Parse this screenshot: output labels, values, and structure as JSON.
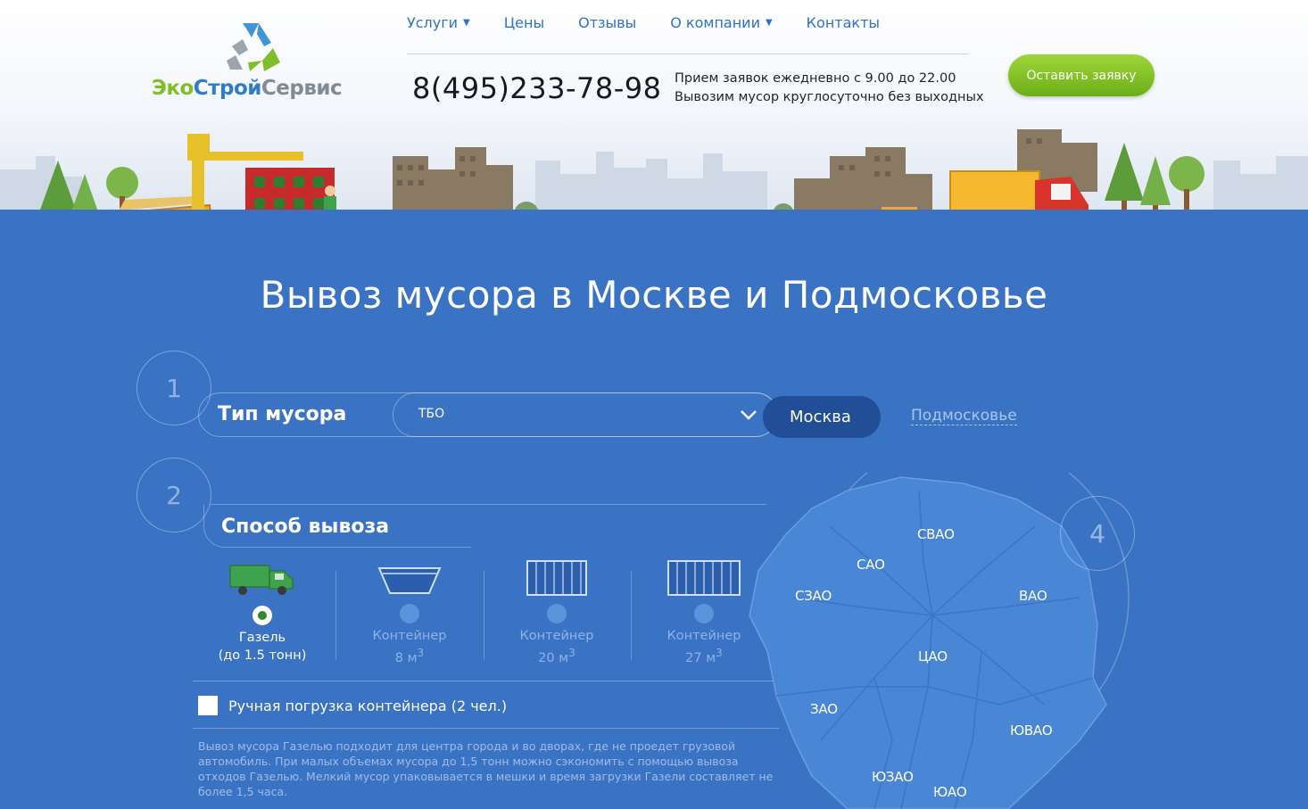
{
  "brand": {
    "logo_part1": "Эко",
    "logo_part2": "Строй",
    "logo_part3": "Сервис",
    "icon": "recycle-icon",
    "colors": {
      "green": "#7fbf2b",
      "blue": "#2f7dc9",
      "grey": "#7f8c97"
    }
  },
  "nav": {
    "items": [
      {
        "label": "Услуги",
        "has_dropdown": true
      },
      {
        "label": "Цены",
        "has_dropdown": false
      },
      {
        "label": "Отзывы",
        "has_dropdown": false
      },
      {
        "label": "О компании",
        "has_dropdown": true
      },
      {
        "label": "Контакты",
        "has_dropdown": false
      }
    ],
    "color": "#2f72c4"
  },
  "contact": {
    "phone": "8(495)233-78-98",
    "hours_line1": "Прием заявок ежедневно с 9.00 до 22.00",
    "hours_line2": "Вывозим мусор круглосуточно без выходных"
  },
  "cta": {
    "label": "Оставить заявку",
    "color": "#7bbd20"
  },
  "hero": {
    "title": "Вывоз мусора в Москве и Подмосковье",
    "background": "#3a72c4"
  },
  "step1": {
    "number": "1",
    "label": "Тип мусора",
    "select_value": "ТБО",
    "regions": {
      "active": "Москва",
      "inactive": "Подмосковье"
    }
  },
  "step2": {
    "number": "2",
    "label": "Способ вывоза",
    "options": [
      {
        "line1": "Газель",
        "line2": "(до 1.5 тонн)",
        "selected": true,
        "icon": "van-icon"
      },
      {
        "line1": "Контейнер",
        "line2": "8 м",
        "sup": "3",
        "selected": false,
        "icon": "container-8-icon"
      },
      {
        "line1": "Контейнер",
        "line2": "20 м",
        "sup": "3",
        "selected": false,
        "icon": "container-20-icon"
      },
      {
        "line1": "Контейнер",
        "line2": "27 м",
        "sup": "3",
        "selected": false,
        "icon": "container-27-icon"
      }
    ],
    "manual_loading": "Ручная погрузка контейнера (2 чел.)",
    "manual_loading_checked": false,
    "description": "Вывоз мусора Газелью подходит для центра города и во дворах, где не проедет грузовой автомобиль. При малых объемах мусора до 1,5 тонн можно сэкономить с помощью вывоза отходов Газелью. Мелкий мусор упаковывается в мешки и время загрузки Газели составляет не более 1,5 часа."
  },
  "step4": {
    "number": "4"
  },
  "map": {
    "districts": [
      "СВАО",
      "САО",
      "СЗАО",
      "ВАО",
      "ЦАО",
      "ЗАО",
      "ЮВАО",
      "ЮЗАО",
      "ЮАО"
    ],
    "fill": "#4a86d6"
  }
}
